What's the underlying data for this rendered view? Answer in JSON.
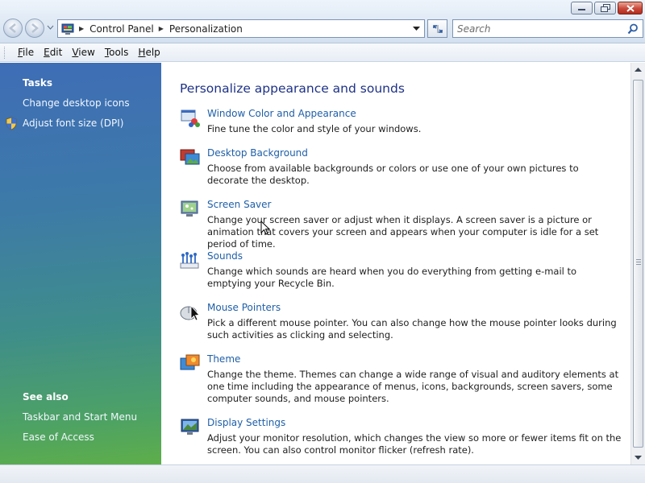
{
  "window": {
    "icons": {
      "minimize": "minimize-icon",
      "maximize": "maximize-icon",
      "close": "close-icon"
    }
  },
  "address_bar": {
    "crumbs": [
      "Control Panel",
      "Personalization"
    ],
    "icon": "control-panel-icon"
  },
  "search": {
    "placeholder": "Search",
    "icon": "magnifier-icon"
  },
  "menu": {
    "items": [
      {
        "label": "File",
        "access_key": "F"
      },
      {
        "label": "Edit",
        "access_key": "E"
      },
      {
        "label": "View",
        "access_key": "V"
      },
      {
        "label": "Tools",
        "access_key": "T"
      },
      {
        "label": "Help",
        "access_key": "H"
      }
    ]
  },
  "sidebar": {
    "tasks_heading": "Tasks",
    "tasks": [
      {
        "label": "Change desktop icons"
      },
      {
        "label": "Adjust font size (DPI)",
        "icon": "uac-shield-icon"
      }
    ],
    "see_also_heading": "See also",
    "see_also": [
      {
        "label": "Taskbar and Start Menu"
      },
      {
        "label": "Ease of Access"
      }
    ]
  },
  "main": {
    "title": "Personalize appearance and sounds",
    "tasks": [
      {
        "title": "Window Color and Appearance",
        "icon": "window-color-icon",
        "description": "Fine tune the color and style of your windows."
      },
      {
        "title": "Desktop Background",
        "icon": "desktop-background-icon",
        "description": "Choose from available backgrounds or colors or use one of your own pictures to decorate the desktop."
      },
      {
        "title": "Screen Saver",
        "icon": "screen-saver-icon",
        "description": "Change your screen saver or adjust when it displays. A screen saver is a picture or animation that covers your screen and appears when your computer is idle for a set period of time."
      },
      {
        "title": "Sounds",
        "icon": "sounds-icon",
        "description": "Change which sounds are heard when you do everything from getting e-mail to emptying your Recycle Bin."
      },
      {
        "title": "Mouse Pointers",
        "icon": "mouse-pointer-icon",
        "description": "Pick a different mouse pointer. You can also change how the mouse pointer looks during such activities as clicking and selecting."
      },
      {
        "title": "Theme",
        "icon": "theme-icon",
        "description": "Change the theme. Themes can change a wide range of visual and auditory elements at one time including the appearance of menus, icons, backgrounds, screen savers, some computer sounds, and mouse pointers."
      },
      {
        "title": "Display Settings",
        "icon": "display-settings-icon",
        "description": "Adjust your monitor resolution, which changes the view so more or fewer items fit on the screen. You can also control monitor flicker (refresh rate)."
      }
    ]
  },
  "colors": {
    "link": "#1f5fa8",
    "title": "#1e3287",
    "sidebar_top": "#3e6db6",
    "sidebar_bottom": "#5eae4a"
  }
}
